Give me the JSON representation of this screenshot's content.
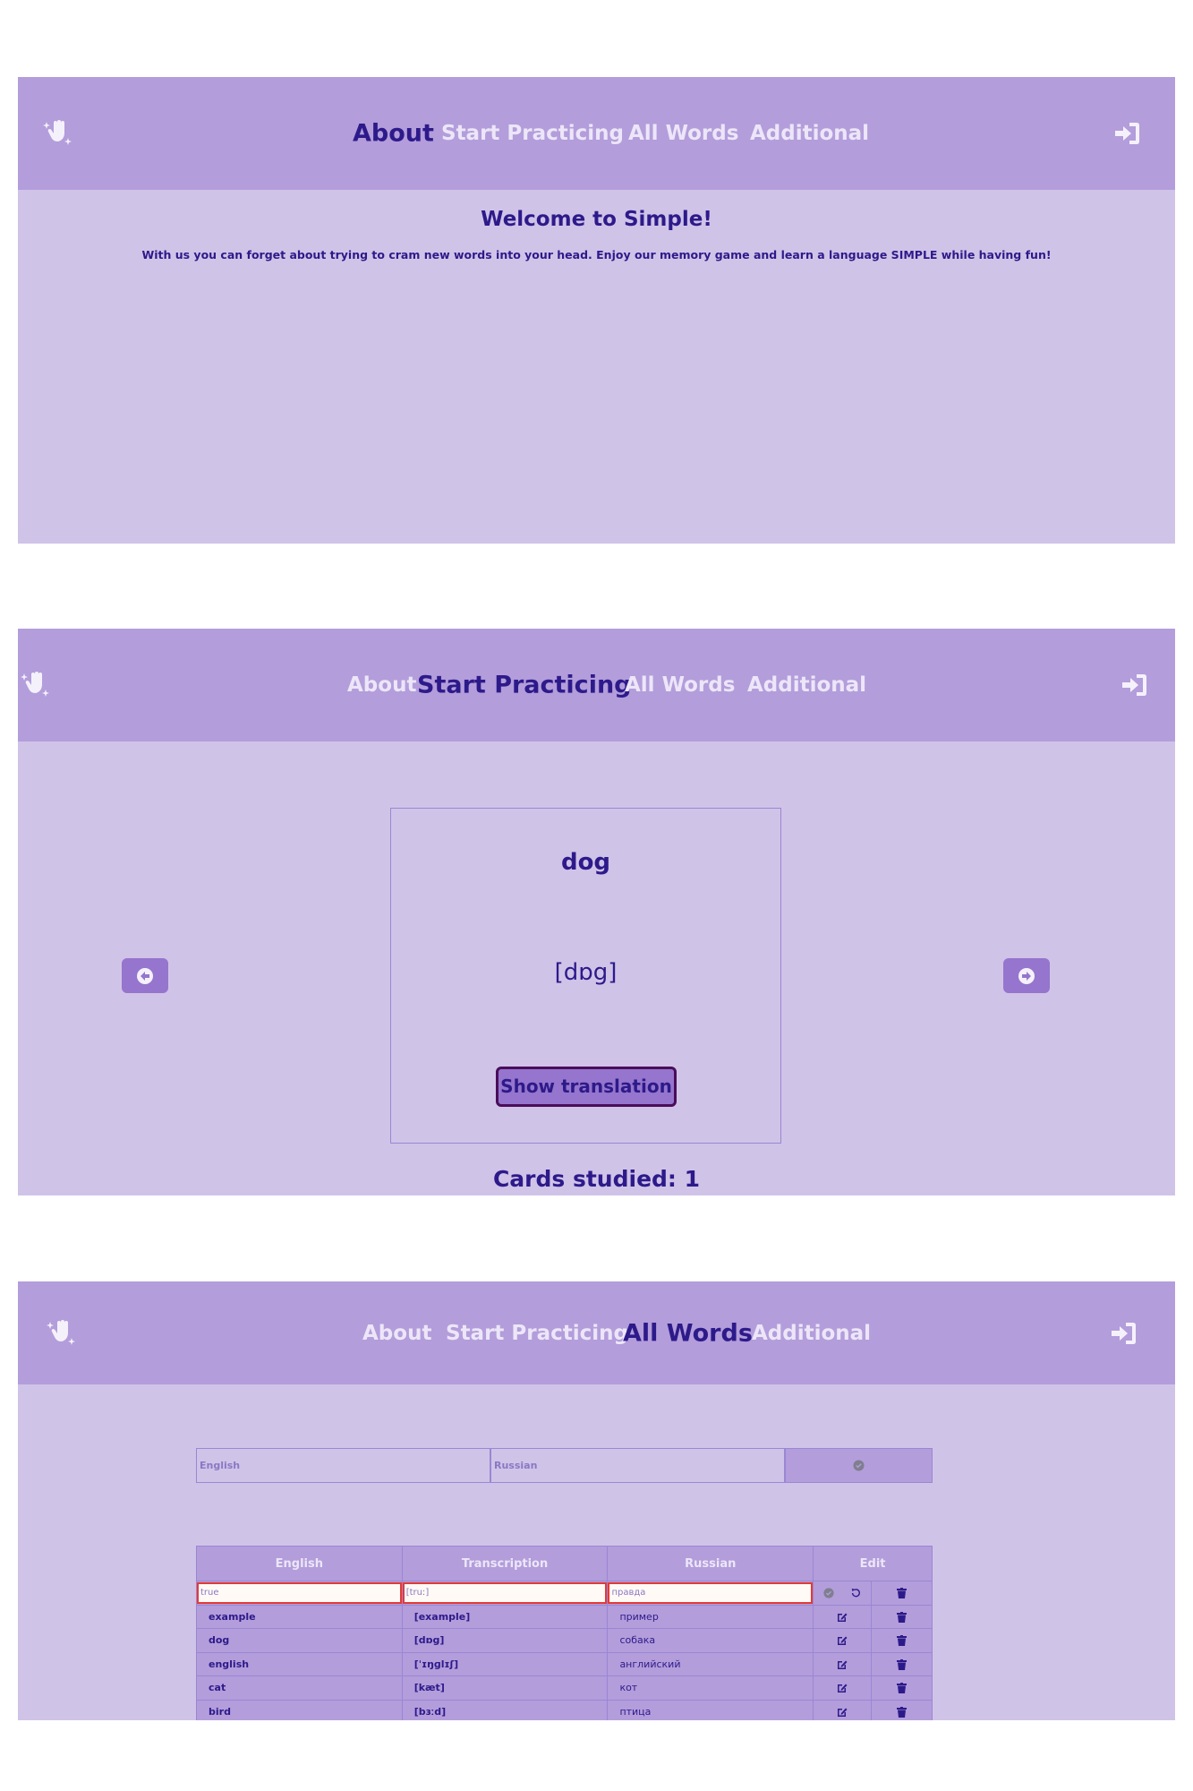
{
  "nav": {
    "about": "About",
    "start": "Start Practicing",
    "all_words": "All Words",
    "additional": "Additional"
  },
  "icons": {
    "logo": "sparkle-hand-icon",
    "login": "sign-in-icon",
    "prev": "arrow-circle-left-icon",
    "next": "arrow-circle-right-icon",
    "confirm": "check-circle-icon",
    "undo": "undo-icon",
    "edit": "edit-icon",
    "delete": "trash-icon"
  },
  "colors": {
    "header": "#b39ddb",
    "background": "#d0c3e8",
    "accent_text": "#2d1a8a",
    "button": "#9575cd",
    "error_border": "#e53935"
  },
  "about_page": {
    "title": "Welcome to Simple!",
    "text": "With us you can forget about trying to cram new words into your head. Enjoy our memory game and learn a language SIMPLE while having fun!"
  },
  "practice_page": {
    "word": "dog",
    "transcription": "[dɒg]",
    "show_translation": "Show translation",
    "studied": "Cards studied: 1"
  },
  "words_page": {
    "add_form": {
      "english_placeholder": "English",
      "russian_placeholder": "Russian"
    },
    "columns": [
      "English",
      "Transcription",
      "Russian",
      "Edit"
    ],
    "editing_row": {
      "english": "true",
      "transcription": "[truː]",
      "russian": "правда"
    },
    "rows": [
      {
        "english": "example",
        "transcription": "[example]",
        "russian": "пример"
      },
      {
        "english": "dog",
        "transcription": "[dɒg]",
        "russian": "собака"
      },
      {
        "english": "english",
        "transcription": "[ˈɪŋɡlɪʃ]",
        "russian": "английский"
      },
      {
        "english": "cat",
        "transcription": "[kæt]",
        "russian": "кот"
      },
      {
        "english": "bird",
        "transcription": "[bɜːd]",
        "russian": "птица"
      }
    ]
  }
}
